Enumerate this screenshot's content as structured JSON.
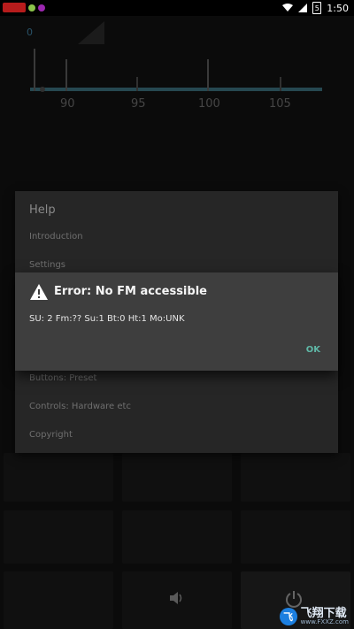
{
  "statusbar": {
    "time": "1:50",
    "battery": "5",
    "icons": [
      "wifi-icon",
      "cell-signal-icon",
      "battery-icon"
    ]
  },
  "radio": {
    "frequency_readout": "0",
    "scale_labels": [
      "90",
      "95",
      "100",
      "105"
    ]
  },
  "help_dialog": {
    "title": "Help",
    "items": [
      "Introduction",
      "Settings",
      "Buttons: Preset",
      "Controls: Hardware etc",
      "Copyright"
    ]
  },
  "error_dialog": {
    "title": "Error: No FM accessible",
    "message": "SU: 2  Fm:?? Su:1 Bt:0 Ht:1 Mo:UNK",
    "ok_label": "OK"
  },
  "controls": {
    "speaker": "speaker-icon",
    "power": "power-icon"
  },
  "watermark": {
    "cn_text": "飞翔下载",
    "url": "www.FXXZ.com"
  },
  "colors": {
    "accent": "#5fb7a6",
    "scale_bar": "#3b6f7d",
    "frequency": "#3f7fa0"
  }
}
